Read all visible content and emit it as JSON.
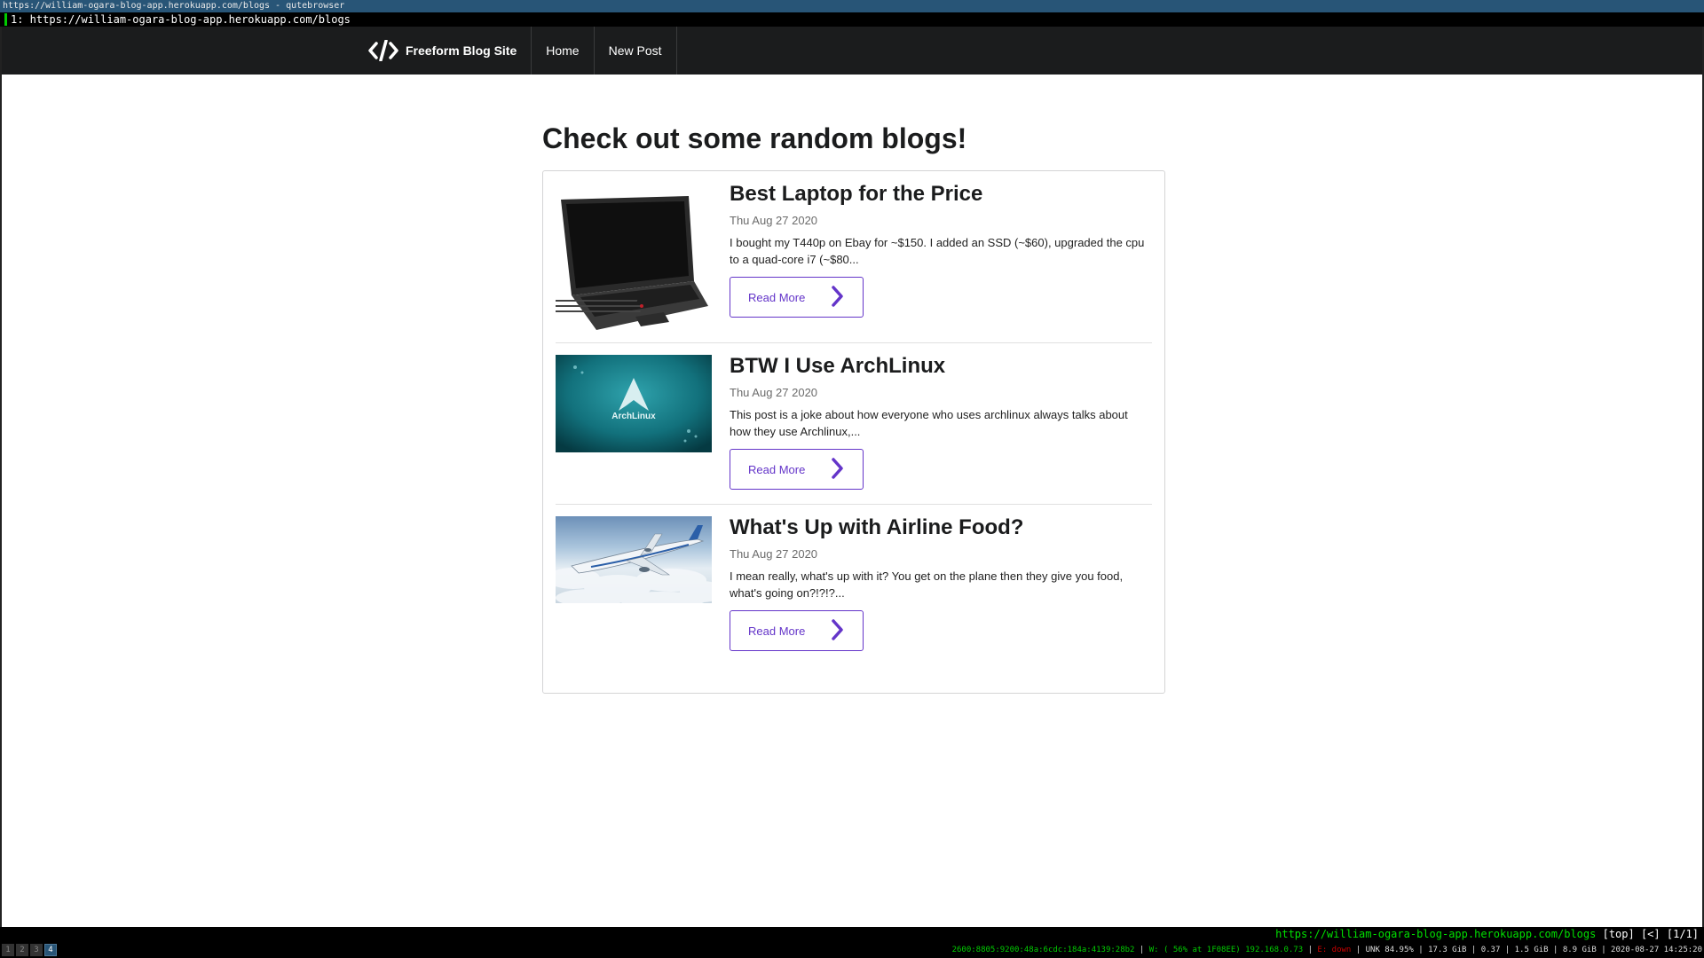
{
  "window": {
    "title": "https://william-ogara-blog-app.herokuapp.com/blogs - qutebrowser"
  },
  "tabbar": {
    "tab_label": "1: https://william-ogara-blog-app.herokuapp.com/blogs"
  },
  "navbar": {
    "brand_icon": "code-icon",
    "brand": "Freeform Blog Site",
    "items": [
      {
        "label": "Home"
      },
      {
        "label": "New Post"
      }
    ]
  },
  "page": {
    "heading": "Check out some random blogs!"
  },
  "blogs": [
    {
      "title": "Best Laptop for the Price",
      "date": "Thu Aug 27 2020",
      "excerpt": "I bought my T440p on Ebay for ~$150. I added an SSD (~$60), upgraded the cpu to a quad-core i7 (~$80...",
      "button": "Read More",
      "image": "laptop-photo"
    },
    {
      "title": "BTW I Use ArchLinux",
      "date": "Thu Aug 27 2020",
      "excerpt": "This post is a joke about how everyone who uses archlinux always talks about how they use Archlinux,...",
      "button": "Read More",
      "image": "archlinux-wallpaper",
      "image_text": "ArchLinux"
    },
    {
      "title": "What's Up with Airline Food?",
      "date": "Thu Aug 27 2020",
      "excerpt": "I mean really, what's up with it? You get on the plane then they give you food, what's going on?!?!?...",
      "button": "Read More",
      "image": "airplane-photo"
    }
  ],
  "statusbar": {
    "url": "https://william-ogara-blog-app.herokuapp.com/blogs",
    "position": "[top]",
    "history": "[<]",
    "tab_index": "[1/1]"
  },
  "i3bar": {
    "workspaces": [
      "1",
      "2",
      "3",
      "4"
    ],
    "active_workspace": "4",
    "ipv6": "2600:8805:9200:48a:6cdc:184a:4139:28b2",
    "wifi": "W: ( 56% at 1F08EE) 192.168.0.73",
    "ethernet": "E: down",
    "battery": "UNK 84.95%",
    "disk": "17.3 GiB",
    "load": "0.37",
    "mem_used": "1.5 GiB",
    "mem_avail": "8.9 GiB",
    "datetime": "2020-08-27 14:25:20"
  },
  "colors": {
    "navbar_bg": "#1b1c1d",
    "accent_purple": "#6435c9",
    "titlebar_bg": "#285577",
    "status_green": "#00e000"
  }
}
